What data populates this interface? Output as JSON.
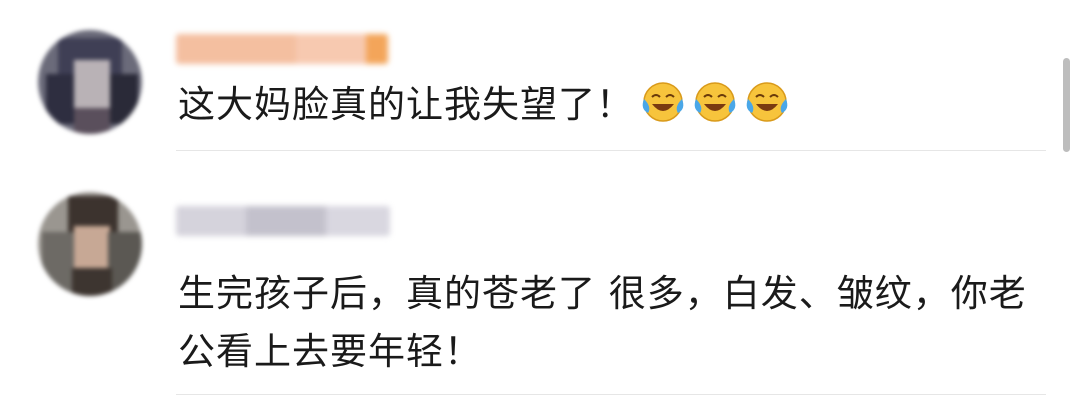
{
  "comments": [
    {
      "text": "这大妈脸真的让我失望了！",
      "emoji": [
        "laugh-cry-icon",
        "laugh-cry-icon",
        "laugh-cry-icon"
      ]
    },
    {
      "text_line1": "生完孩子后，真的苍老了 很多，白发、皱纹，你老",
      "text_line2": "公看上去要年轻！"
    }
  ],
  "colors": {
    "name1": "#f2b58a",
    "name2": "#cfcfd6",
    "emoji_face": "#f7c43c",
    "tears": "#4aa7e8"
  }
}
